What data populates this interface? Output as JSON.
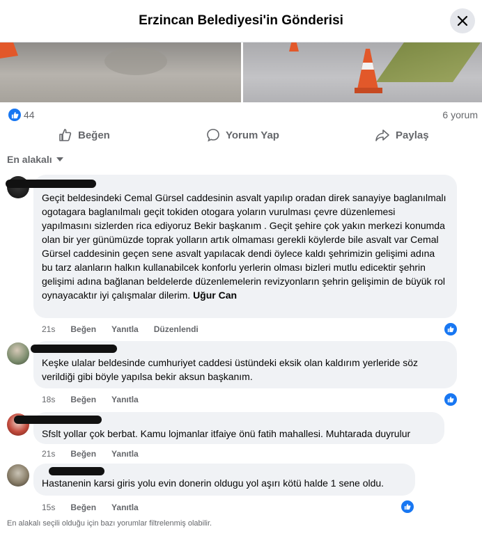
{
  "header": {
    "title": "Erzincan Belediyesi'in Gönderisi"
  },
  "stats": {
    "like_count": "44",
    "comment_count": "6 yorum"
  },
  "actions": {
    "like": "Beğen",
    "comment": "Yorum Yap",
    "share": "Paylaş"
  },
  "sort": {
    "label": "En alakalı"
  },
  "comments": [
    {
      "text": "Geçit beldesindeki Cemal Gürsel caddesinin asvalt yapılıp oradan direk sanayiye baglanılmalı ogotagara baglanılmalı geçit tokiden otogara yoların vurulması çevre düzenlemesi yapılmasını sizlerden rica ediyoruz Bekir başkanım . Geçit şehire çok yakın merkezi konumda olan bir yer günümüzde toprak yolların artık olmaması gerekli köylerde bile asvalt var Cemal Gürsel caddesinin geçen sene asvalt yapılacak dendi öylece kaldı şehrimizin gelişimi adına bu tarz alanların halkın kullanabilcek konforlu yerlerin olması bizleri mutlu edicektir şehrin gelişimi adına bağlanan beldelerde düzenlemelerin revizyonların şehrin gelişimin de büyük rol oynayacaktır iyi çalışmalar dilerim.",
      "mention": "Uğur Can",
      "time": "21s",
      "like": "Beğen",
      "reply": "Yanıtla",
      "edited": "Düzenlendi"
    },
    {
      "text": "Keşke ulalar beldesinde cumhuriyet caddesi üstündeki eksik olan kaldırım yerleride söz verildiği gibi böyle yapılsa bekir aksun başkanım.",
      "time": "18s",
      "like": "Beğen",
      "reply": "Yanıtla"
    },
    {
      "text": "Sfslt yollar çok berbat. Kamu lojmanlar itfaiye önü fatih mahallesi. Muhtarada duyrulur",
      "time": "21s",
      "like": "Beğen",
      "reply": "Yanıtla"
    },
    {
      "text": "Hastanenin karsi giris yolu evin donerin oldugu yol aşırı kötü halde 1 sene oldu.",
      "time": "15s",
      "like": "Beğen",
      "reply": "Yanıtla"
    }
  ],
  "footer": {
    "note": "En alakalı seçili olduğu için bazı yorumlar filtrelenmiş olabilir."
  },
  "colors": {
    "accent": "#1877f2",
    "bubble": "#f0f2f5",
    "muted": "#65676b",
    "cone": "#e2582a"
  }
}
